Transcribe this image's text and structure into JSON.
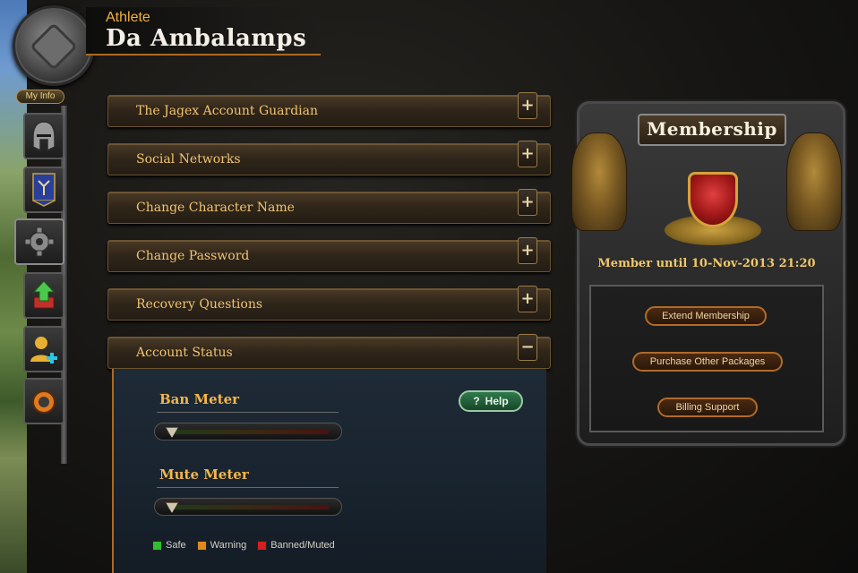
{
  "header": {
    "title_label": "Athlete",
    "player_name": "Da Ambalamps"
  },
  "sidebar": {
    "my_info_label": "My Info",
    "buttons": [
      {
        "icon": "helmet-icon"
      },
      {
        "icon": "banner-icon"
      },
      {
        "icon": "gear-icon"
      },
      {
        "icon": "upgrade-arrow-icon"
      },
      {
        "icon": "add-friend-icon"
      },
      {
        "icon": "bomb-icon"
      }
    ],
    "active_index": 2
  },
  "accordion": [
    {
      "label": "The Jagex Account Guardian",
      "toggle": "+"
    },
    {
      "label": "Social Networks",
      "toggle": "+"
    },
    {
      "label": "Change Character Name",
      "toggle": "+"
    },
    {
      "label": "Change Password",
      "toggle": "+"
    },
    {
      "label": "Recovery Questions",
      "toggle": "+"
    },
    {
      "label": "Account Status",
      "toggle": "−"
    }
  ],
  "account_status": {
    "help_label": "Help",
    "help_icon": "question-icon",
    "ban_meter": {
      "label": "Ban Meter",
      "level": 0.0
    },
    "mute_meter": {
      "label": "Mute Meter",
      "level": 0.0
    },
    "legend": [
      {
        "label": "Safe",
        "color": "#2fbf2f"
      },
      {
        "label": "Warning",
        "color": "#e08a1e"
      },
      {
        "label": "Banned/Muted",
        "color": "#d21f1f"
      }
    ]
  },
  "membership": {
    "title": "Membership",
    "until_text": "Member until 10-Nov-2013 21:20",
    "buttons": [
      "Extend Membership",
      "Purchase Other Packages",
      "Billing Support"
    ]
  }
}
